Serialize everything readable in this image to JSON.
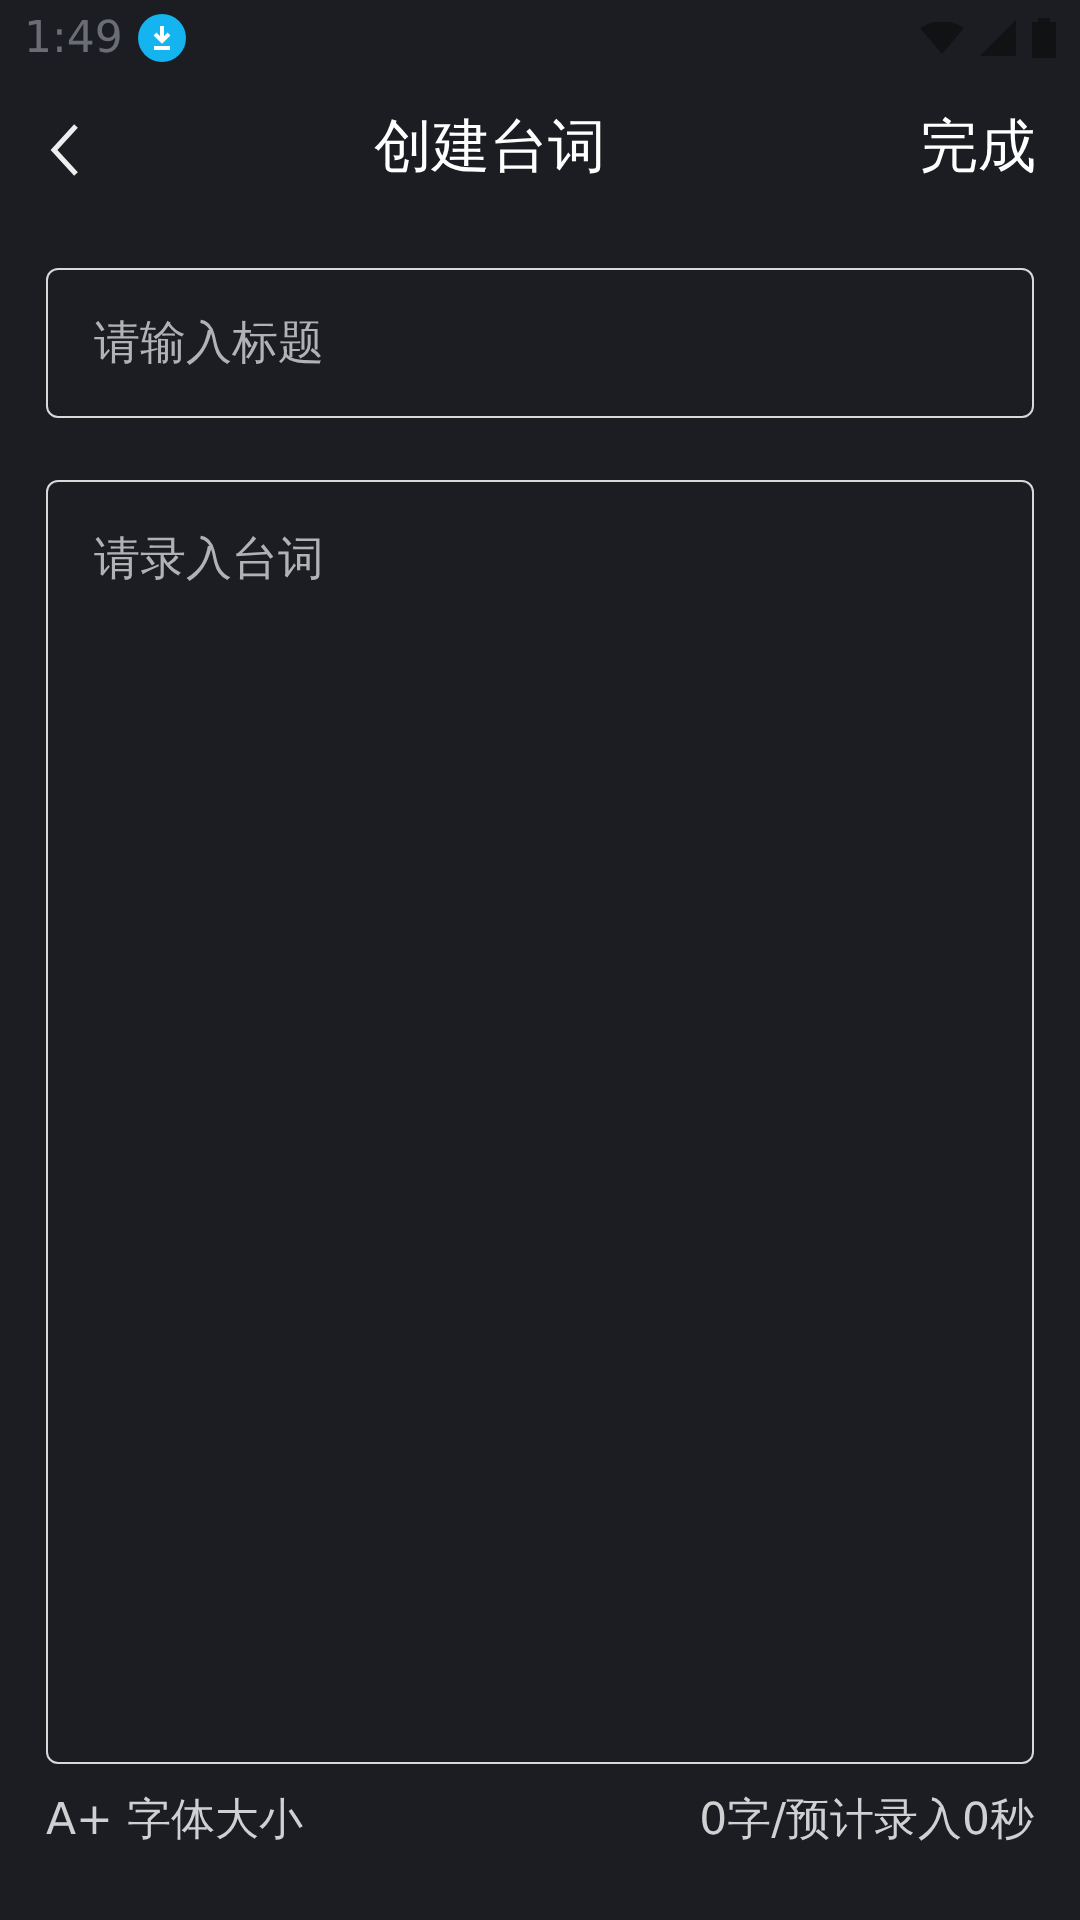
{
  "status_bar": {
    "time": "1:49"
  },
  "header": {
    "title": "创建台词",
    "done": "完成"
  },
  "title_field": {
    "placeholder": "请输入标题"
  },
  "script_field": {
    "placeholder": "请录入台词"
  },
  "footer": {
    "font_size": "A+ 字体大小",
    "count": "0字/预计录入0秒"
  }
}
